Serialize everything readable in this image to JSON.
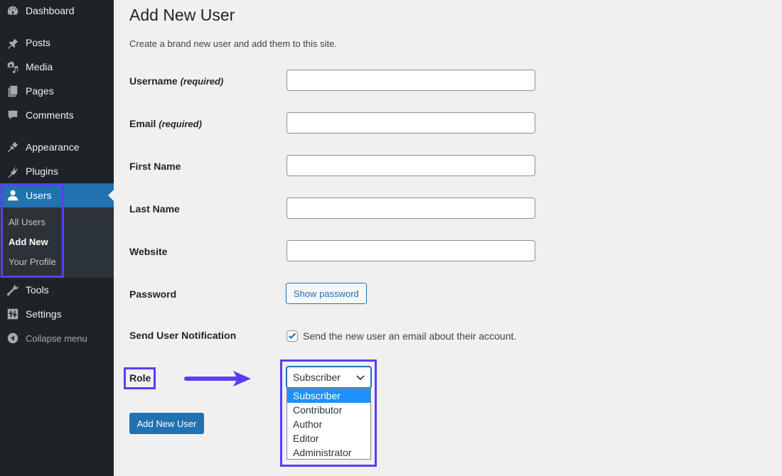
{
  "sidebar": {
    "items": [
      {
        "label": "Dashboard",
        "icon": "dashboard-icon"
      },
      {
        "label": "Posts",
        "icon": "pin-icon"
      },
      {
        "label": "Media",
        "icon": "media-icon"
      },
      {
        "label": "Pages",
        "icon": "pages-icon"
      },
      {
        "label": "Comments",
        "icon": "comment-icon"
      },
      {
        "label": "Appearance",
        "icon": "paintbrush-icon"
      },
      {
        "label": "Plugins",
        "icon": "plugin-icon"
      },
      {
        "label": "Users",
        "icon": "user-icon",
        "active": true
      },
      {
        "label": "Tools",
        "icon": "wrench-icon"
      },
      {
        "label": "Settings",
        "icon": "settings-icon"
      }
    ],
    "submenu": [
      {
        "label": "All Users"
      },
      {
        "label": "Add New",
        "current": true
      },
      {
        "label": "Your Profile"
      }
    ],
    "collapse_label": "Collapse menu"
  },
  "page": {
    "title": "Add New User",
    "description": "Create a brand new user and add them to this site.",
    "required_hint": "(required)",
    "fields": [
      {
        "label": "Username",
        "required": true,
        "value": ""
      },
      {
        "label": "Email",
        "required": true,
        "value": ""
      },
      {
        "label": "First Name",
        "required": false,
        "value": ""
      },
      {
        "label": "Last Name",
        "required": false,
        "value": ""
      },
      {
        "label": "Website",
        "required": false,
        "value": ""
      }
    ],
    "password_label": "Password",
    "show_password_button": "Show password",
    "notification_label": "Send User Notification",
    "notification_checkbox_label": "Send the new user an email about their account.",
    "notification_checked": true,
    "role_label": "Role",
    "role_selected": "Subscriber",
    "role_options": [
      "Subscriber",
      "Contributor",
      "Author",
      "Editor",
      "Administrator"
    ],
    "submit_button": "Add New User"
  },
  "colors": {
    "accent": "#2271b1",
    "highlight": "#5b3df5",
    "sidebar_bg": "#1d2327",
    "option_selected": "#1e90ff"
  }
}
